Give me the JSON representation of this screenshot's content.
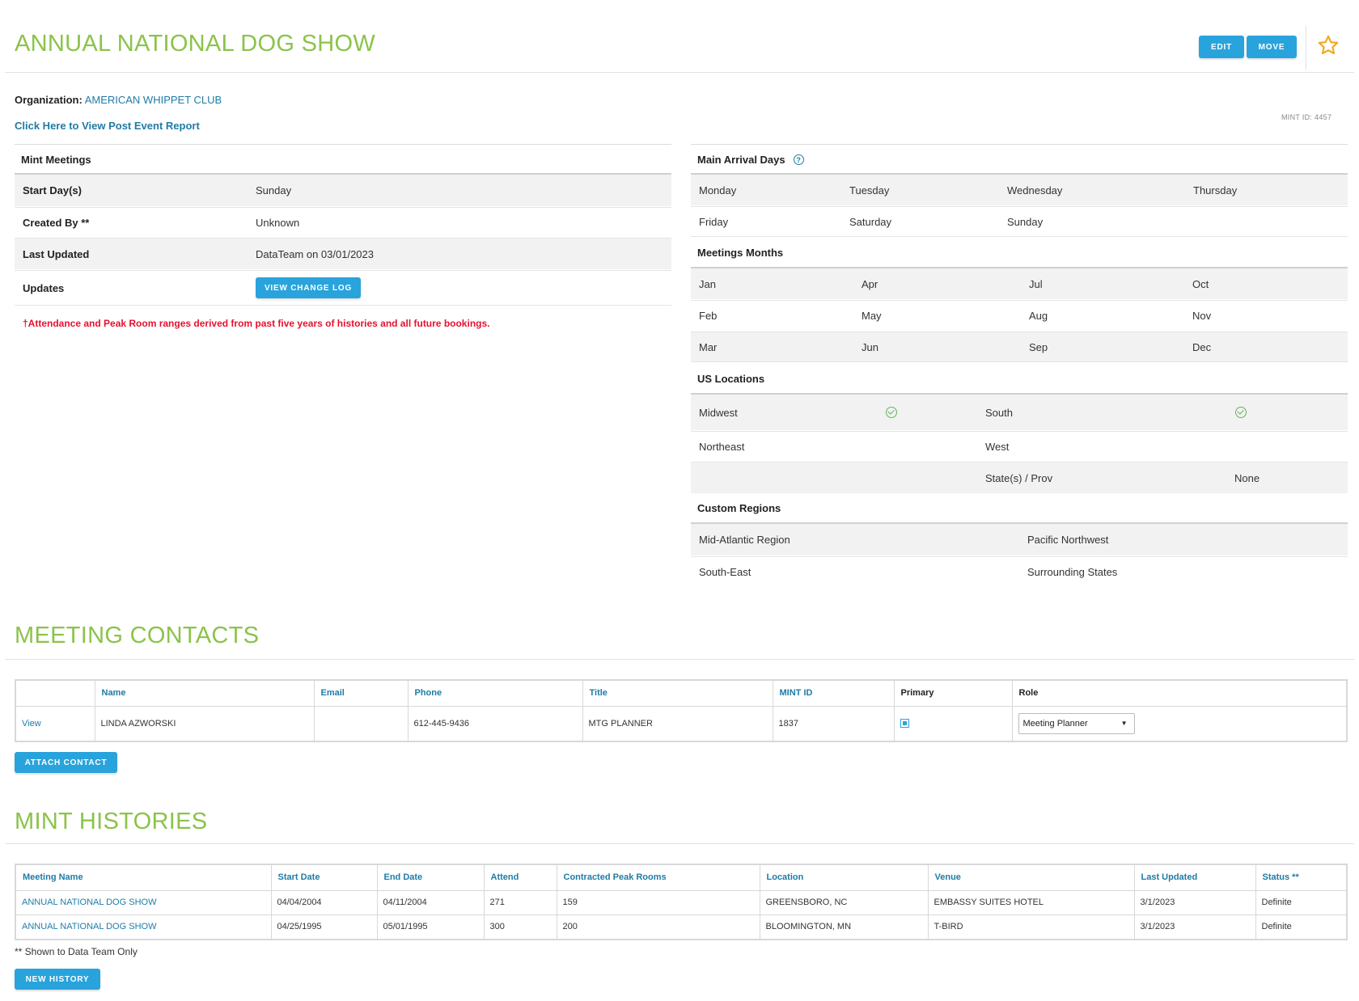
{
  "header": {
    "title": "ANNUAL NATIONAL DOG SHOW",
    "edit_label": "EDIT",
    "move_label": "MOVE"
  },
  "organization": {
    "label": "Organization:",
    "value": "AMERICAN WHIPPET CLUB"
  },
  "post_event_link": "Click Here to View Post Event Report",
  "mint_id": "MINT ID: 4457",
  "mint_meetings": {
    "heading": "Mint Meetings",
    "rows": [
      {
        "key": "Start Day(s)",
        "value": "Sunday"
      },
      {
        "key": "Created By **",
        "value": "Unknown"
      },
      {
        "key": "Last Updated",
        "value": "DataTeam on 03/01/2023"
      },
      {
        "key": "Updates",
        "button": "VIEW CHANGE LOG"
      }
    ],
    "note": "†Attendance and Peak Room ranges derived from past five years of histories and all future bookings."
  },
  "arrival_days": {
    "heading": "Main Arrival Days",
    "help_icon": "?",
    "row1": [
      "Monday",
      "Tuesday",
      "Wednesday",
      "Thursday"
    ],
    "row2": [
      "Friday",
      "Saturday",
      "Sunday"
    ]
  },
  "meetings_months": {
    "heading": "Meetings Months",
    "rows": [
      [
        "Jan",
        "Apr",
        "Jul",
        "Oct"
      ],
      [
        "Feb",
        "May",
        "Aug",
        "Nov"
      ],
      [
        "Mar",
        "Jun",
        "Sep",
        "Dec"
      ]
    ]
  },
  "us_locations": {
    "heading": "US Locations",
    "midwest": "Midwest",
    "south": "South",
    "northeast": "Northeast",
    "west": "West",
    "states_label": "State(s) / Prov",
    "states_value": "None",
    "midwest_checked": true,
    "south_checked": true
  },
  "custom_regions": {
    "heading": "Custom Regions",
    "rows": [
      [
        "Mid-Atlantic Region",
        "Pacific Northwest"
      ],
      [
        "South-East",
        "Surrounding States"
      ]
    ]
  },
  "contacts": {
    "title": "MEETING CONTACTS",
    "columns": [
      "",
      "Name",
      "Email",
      "Phone",
      "Title",
      "MINT ID",
      "Primary",
      "Role"
    ],
    "rows": [
      {
        "view": "View",
        "name": "LINDA AZWORSKI",
        "email": "",
        "phone": "612-445-9436",
        "title": "MTG PLANNER",
        "mint_id": "1837",
        "primary": true,
        "role": "Meeting Planner"
      }
    ],
    "attach_label": "ATTACH CONTACT"
  },
  "histories": {
    "title": "MINT HISTORIES",
    "columns": [
      "Meeting Name",
      "Start Date",
      "End Date",
      "Attend",
      "Contracted Peak Rooms",
      "Location",
      "Venue",
      "Last Updated",
      "Status **"
    ],
    "rows": [
      [
        "ANNUAL NATIONAL DOG SHOW",
        "04/04/2004",
        "04/11/2004",
        "271",
        "159",
        "GREENSBORO, NC",
        "EMBASSY SUITES HOTEL",
        "3/1/2023",
        "Definite"
      ],
      [
        "ANNUAL NATIONAL DOG SHOW",
        "04/25/1995",
        "05/01/1995",
        "300",
        "200",
        "BLOOMINGTON, MN",
        "T-BIRD",
        "3/1/2023",
        "Definite"
      ]
    ],
    "footnote": "** Shown to Data Team Only",
    "new_label": "NEW HISTORY"
  },
  "colors": {
    "title_green": "#8bc34a",
    "button_blue": "#29a3dc",
    "link_blue": "#1f7ba6",
    "star_gold": "#f0a818",
    "note_red": "#e8102e"
  }
}
